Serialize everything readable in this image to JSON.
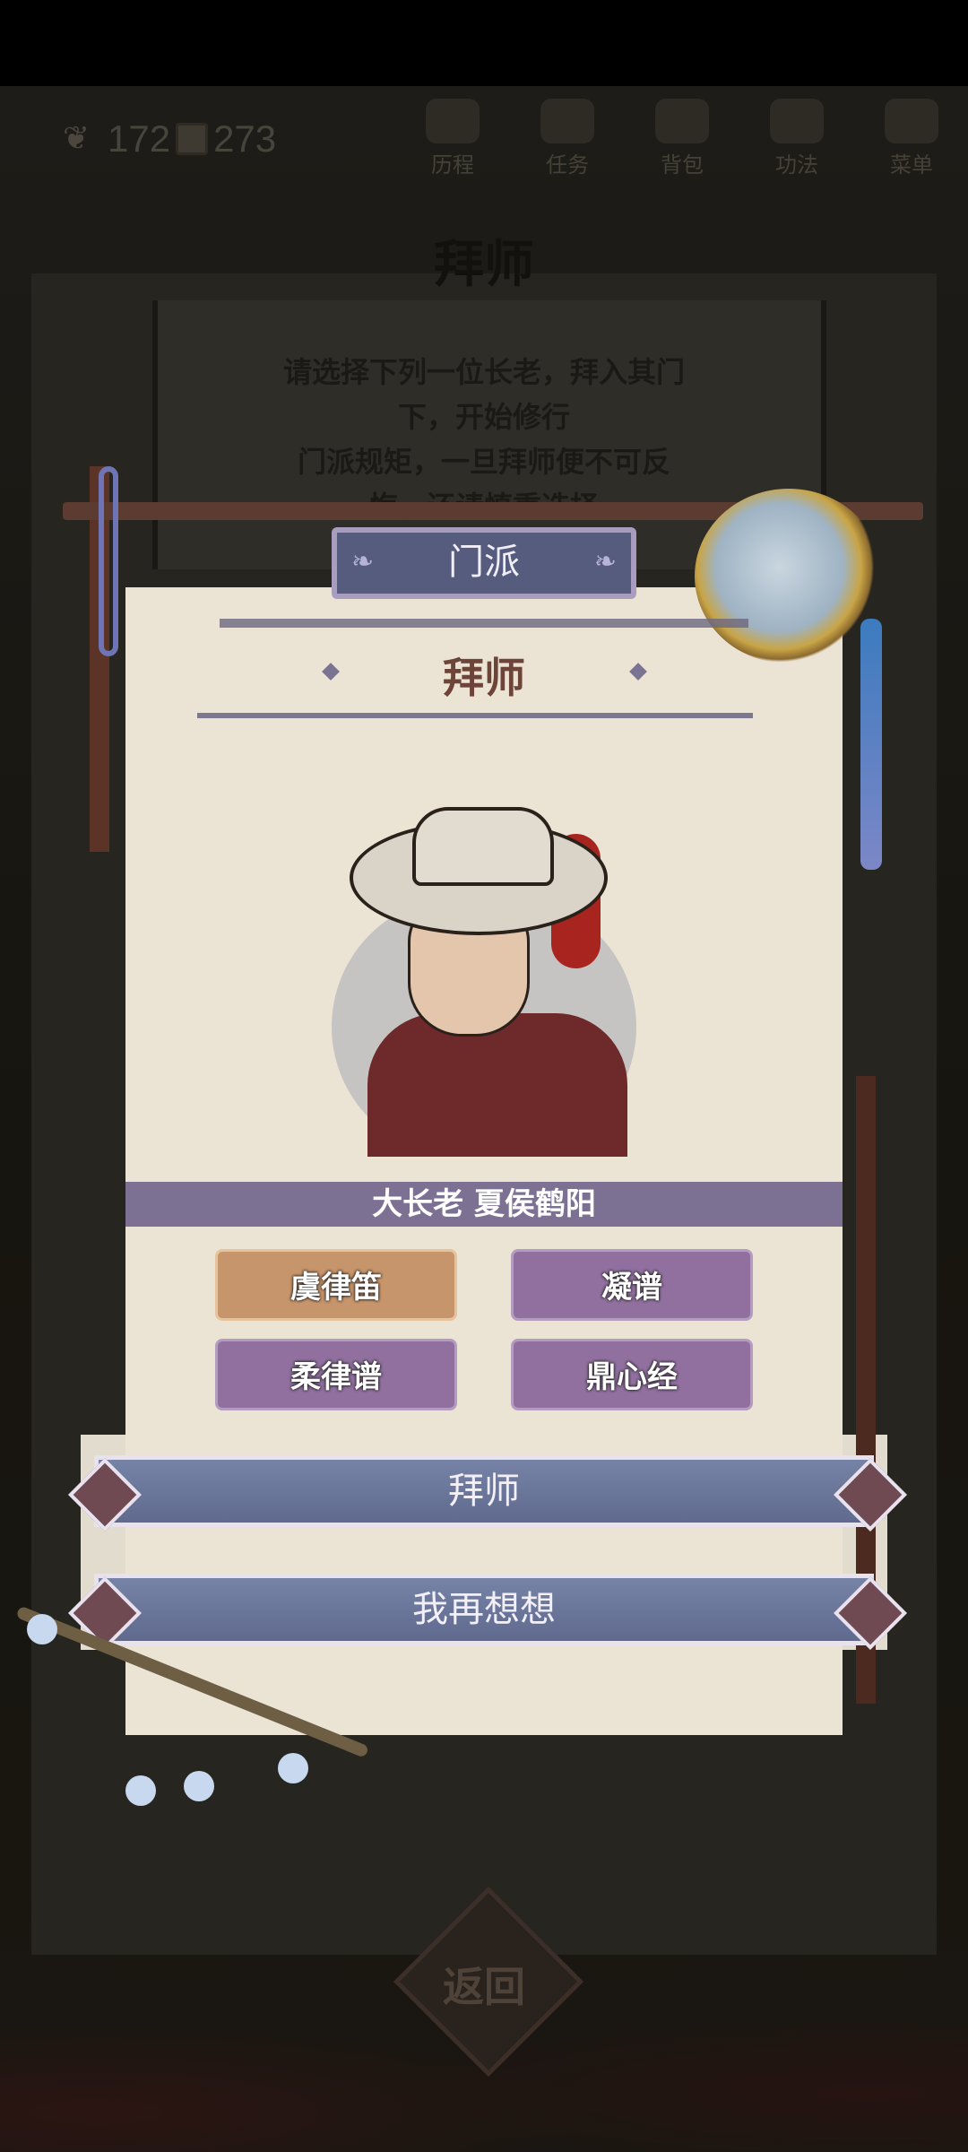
{
  "resources": {
    "stamina": "172",
    "coins": "273"
  },
  "top_menu": [
    "历程",
    "任务",
    "背包",
    "功法",
    "菜单"
  ],
  "background": {
    "title": "拜师",
    "text_lines": [
      "请选择下列一位长老，拜入其门",
      "下，开始修行",
      "门派规矩，一旦拜师便不可反",
      "悔，还请慎重选择"
    ]
  },
  "dialog": {
    "tab": "门派",
    "title": "拜师",
    "elder_name": "大长老 夏侯鹤阳",
    "skills": [
      "虞律笛",
      "凝谱",
      "柔律谱",
      "鼎心经"
    ],
    "selected_skill": "虞律笛",
    "confirm_label": "拜师",
    "reconsider_label": "我再想想"
  },
  "back_label": "返回",
  "colors": {
    "accent": "#7682a6",
    "selected": "#c7956b",
    "skill": "#91709f",
    "name_bar": "#7d7193"
  }
}
